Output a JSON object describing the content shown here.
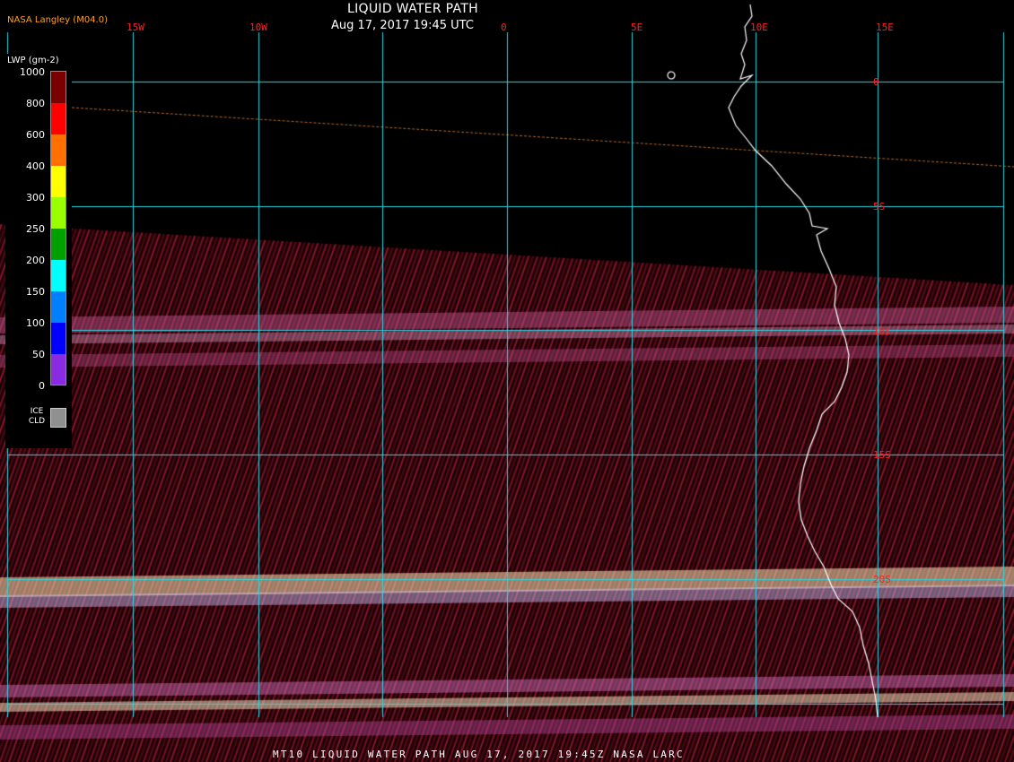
{
  "header": {
    "agency": "NASA Langley (M04.0)",
    "title": "LIQUID WATER PATH",
    "subtitle": "Aug 17, 2017 19:45 UTC"
  },
  "footer": {
    "text": "MT10  LIQUID WATER PATH   AUG 17, 2017 19:45Z   NASA LARC"
  },
  "colors": {
    "grid": "#2bd6e0",
    "grid_label": "#ff2020",
    "coast": "#ffffff",
    "background": "#000000",
    "agency_text": "#ffa31a",
    "swath_base": "#6e0a1a"
  },
  "map": {
    "longitude_labels": [
      "15W",
      "10W",
      "0",
      "5E",
      "10E",
      "15E"
    ],
    "latitude_labels": [
      "0",
      "5S",
      "10S",
      "15S",
      "20S"
    ]
  },
  "legend": {
    "title": "LWP (gm-2)",
    "tick_labels": [
      "1000",
      "800",
      "600",
      "400",
      "300",
      "250",
      "200",
      "150",
      "100",
      "50",
      "0"
    ],
    "colors": [
      "#7a0000",
      "#ff0000",
      "#ff7000",
      "#ffff00",
      "#9aff00",
      "#00a000",
      "#00ffff",
      "#0080ff",
      "#0000ff",
      "#8a2be2"
    ],
    "ice_label": "ICE CLD",
    "ice_color": "#909090"
  }
}
